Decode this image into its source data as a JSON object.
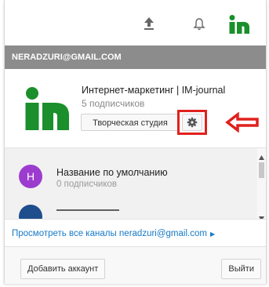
{
  "header": {
    "icons": [
      "upload-icon",
      "bell-icon",
      "account-logo-icon"
    ]
  },
  "account": {
    "email": "NERADZURI@GMAIL.COM",
    "channel_name": "Интернет-маркетинг | IM-journal",
    "subscribers": "5 подписчиков",
    "studio_label": "Творческая студия",
    "gear_icon": "gear-icon"
  },
  "channels": {
    "items": [
      {
        "initial": "H",
        "name": "Название по умолчанию",
        "subscribers": "0 подписчиков",
        "color": "#9c3ccf"
      }
    ]
  },
  "links": {
    "view_all": "Просмотреть все каналы neradzuri@gmail.com"
  },
  "footer": {
    "add_account_label": "Добавить аккаунт",
    "signout_label": "Выйти"
  },
  "colors": {
    "brand_green": "#1a8f2c",
    "highlight_red": "#e0211d",
    "link_blue": "#167ac6",
    "email_bar": "#8c8c8c"
  }
}
